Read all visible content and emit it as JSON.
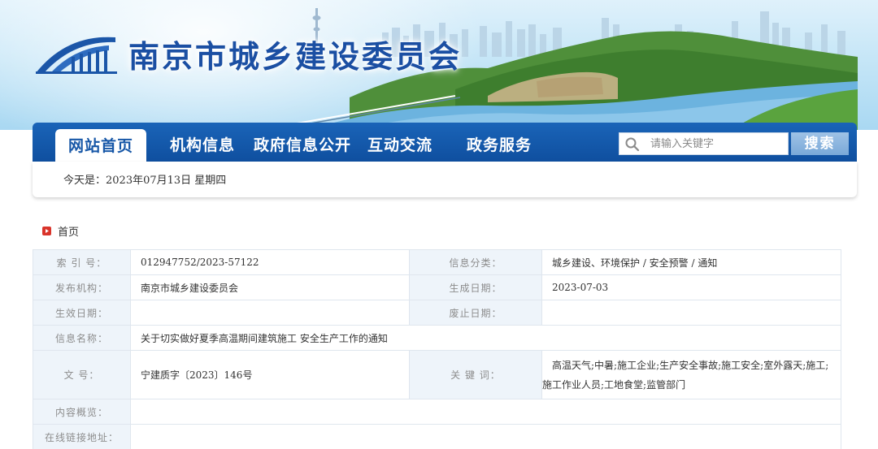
{
  "header": {
    "site_title": "南京市城乡建设委员会"
  },
  "nav": {
    "items": [
      {
        "label": "网站首页",
        "active": true
      },
      {
        "label": "机构信息",
        "active": false
      },
      {
        "label": "政府信息公开",
        "active": false
      },
      {
        "label": "互动交流",
        "active": false
      },
      {
        "label": "政务服务",
        "active": false
      }
    ],
    "search_placeholder": "请输入关键字",
    "search_button": "搜索"
  },
  "datebar": {
    "text": "今天是：2023年07月13日  星期四"
  },
  "breadcrumb": {
    "home_label": "首页"
  },
  "info": {
    "index_label": "索  引  号：",
    "index_value": "012947752/2023-57122",
    "category_label": "信息分类：",
    "category_value": "城乡建设、环境保护 / 安全预警 / 通知",
    "publisher_label": "发布机构：",
    "publisher_value": "南京市城乡建设委员会",
    "created_label": "生成日期：",
    "created_value": "2023-07-03",
    "effective_label": "生效日期：",
    "effective_value": "",
    "abolished_label": "废止日期：",
    "abolished_value": "",
    "name_label": "信息名称：",
    "name_value": "关于切实做好夏季高温期间建筑施工 安全生产工作的通知",
    "docno_label": "文      号：",
    "docno_value": "宁建质字〔2023〕146号",
    "keywords_label": "关  键  词：",
    "keywords_value": "高温天气;中暑;施工企业;生产安全事故;施工安全;室外露天;施工;施工作业人员;工地食堂;监管部门",
    "summary_label": "内容概览：",
    "summary_value": "",
    "link_label": "在线链接地址：",
    "link_value": ""
  },
  "colors": {
    "nav_blue": "#1757a7",
    "label_bg": "#eef4fa",
    "title_blue": "#1b4fa3"
  }
}
